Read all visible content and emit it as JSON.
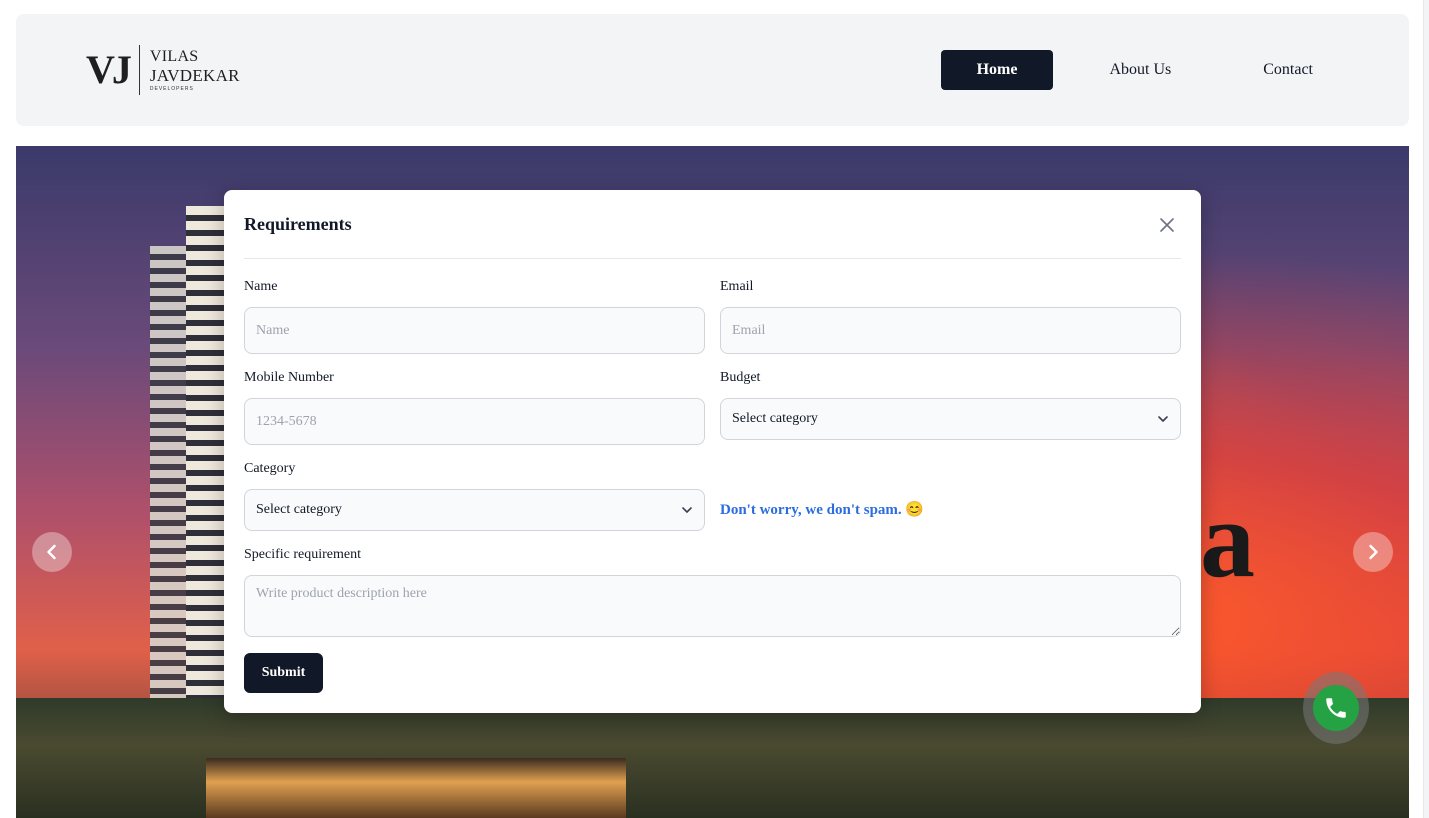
{
  "header": {
    "logo": {
      "mark": "VJ",
      "line1": "VILAS",
      "line2": "JAVDEKAR",
      "line3": "DEVELOPERS"
    },
    "nav": [
      {
        "label": "Home",
        "active": true
      },
      {
        "label": "About Us",
        "active": false
      },
      {
        "label": "Contact",
        "active": false
      }
    ]
  },
  "hero": {
    "letter": "a"
  },
  "modal": {
    "title": "Requirements",
    "fields": {
      "name": {
        "label": "Name",
        "placeholder": "Name"
      },
      "email": {
        "label": "Email",
        "placeholder": "Email"
      },
      "mobile": {
        "label": "Mobile Number",
        "placeholder": "1234-5678"
      },
      "budget": {
        "label": "Budget",
        "selected": "Select category"
      },
      "category": {
        "label": "Category",
        "selected": "Select category"
      },
      "requirement": {
        "label": "Specific requirement",
        "placeholder": "Write product description here"
      }
    },
    "spam_note": "Don't worry, we don't spam. 😊",
    "submit_label": "Submit"
  },
  "colors": {
    "primary": "#111827",
    "note_blue": "#2b6de0",
    "whatsapp_green": "#25a244"
  }
}
